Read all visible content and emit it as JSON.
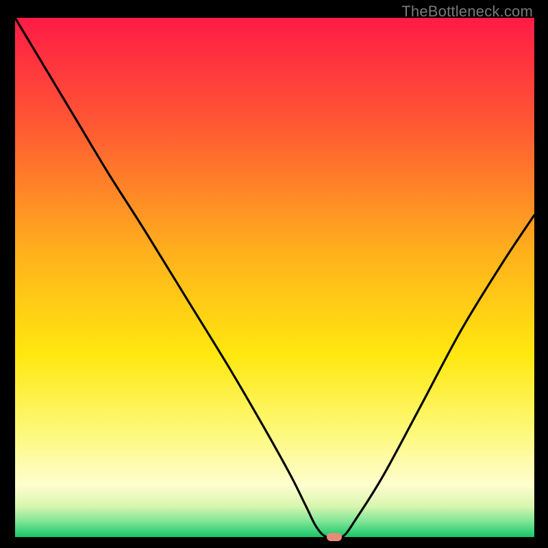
{
  "watermark": {
    "text": "TheBottleneck.com"
  },
  "chart_data": {
    "type": "line",
    "title": "",
    "xlabel": "",
    "ylabel": "",
    "xlim": [
      0,
      100
    ],
    "ylim": [
      0,
      100
    ],
    "gradient": {
      "stops": [
        {
          "pct": 0,
          "color": "#ff1b46"
        },
        {
          "pct": 20,
          "color": "#ff5634"
        },
        {
          "pct": 45,
          "color": "#ffb01c"
        },
        {
          "pct": 65,
          "color": "#ffe80f"
        },
        {
          "pct": 80,
          "color": "#fdf97c"
        },
        {
          "pct": 90,
          "color": "#fefecf"
        },
        {
          "pct": 94,
          "color": "#d9f6b0"
        },
        {
          "pct": 97,
          "color": "#7fe596"
        },
        {
          "pct": 100,
          "color": "#18c667"
        }
      ]
    },
    "series": [
      {
        "name": "bottleneck-curve",
        "x": [
          0,
          6,
          12,
          18,
          25,
          33,
          41,
          48,
          53,
          56,
          58,
          60,
          63,
          66,
          71,
          78,
          86,
          94,
          100
        ],
        "y": [
          100,
          90,
          80,
          70,
          59,
          46,
          33,
          21,
          12,
          6,
          2,
          0,
          0,
          4,
          12,
          25,
          40,
          53,
          62
        ]
      }
    ],
    "marker": {
      "x": 61.5,
      "y": 0,
      "color": "#e88a7a"
    }
  }
}
